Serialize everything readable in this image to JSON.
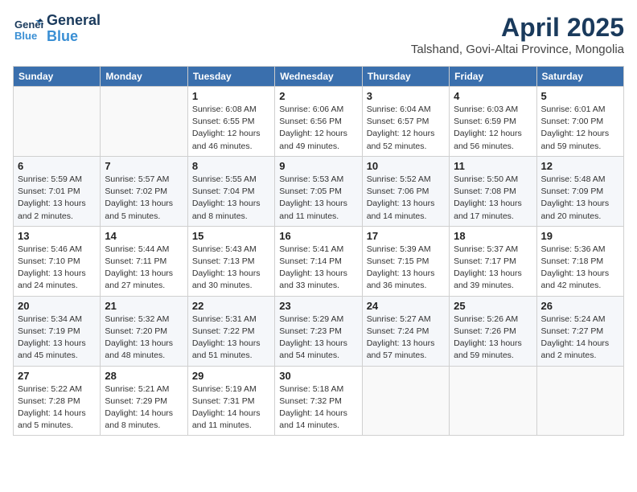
{
  "header": {
    "logo_line1": "General",
    "logo_line2": "Blue",
    "month_year": "April 2025",
    "location": "Talshand, Govi-Altai Province, Mongolia"
  },
  "weekdays": [
    "Sunday",
    "Monday",
    "Tuesday",
    "Wednesday",
    "Thursday",
    "Friday",
    "Saturday"
  ],
  "weeks": [
    [
      {
        "day": "",
        "detail": ""
      },
      {
        "day": "",
        "detail": ""
      },
      {
        "day": "1",
        "detail": "Sunrise: 6:08 AM\nSunset: 6:55 PM\nDaylight: 12 hours\nand 46 minutes."
      },
      {
        "day": "2",
        "detail": "Sunrise: 6:06 AM\nSunset: 6:56 PM\nDaylight: 12 hours\nand 49 minutes."
      },
      {
        "day": "3",
        "detail": "Sunrise: 6:04 AM\nSunset: 6:57 PM\nDaylight: 12 hours\nand 52 minutes."
      },
      {
        "day": "4",
        "detail": "Sunrise: 6:03 AM\nSunset: 6:59 PM\nDaylight: 12 hours\nand 56 minutes."
      },
      {
        "day": "5",
        "detail": "Sunrise: 6:01 AM\nSunset: 7:00 PM\nDaylight: 12 hours\nand 59 minutes."
      }
    ],
    [
      {
        "day": "6",
        "detail": "Sunrise: 5:59 AM\nSunset: 7:01 PM\nDaylight: 13 hours\nand 2 minutes."
      },
      {
        "day": "7",
        "detail": "Sunrise: 5:57 AM\nSunset: 7:02 PM\nDaylight: 13 hours\nand 5 minutes."
      },
      {
        "day": "8",
        "detail": "Sunrise: 5:55 AM\nSunset: 7:04 PM\nDaylight: 13 hours\nand 8 minutes."
      },
      {
        "day": "9",
        "detail": "Sunrise: 5:53 AM\nSunset: 7:05 PM\nDaylight: 13 hours\nand 11 minutes."
      },
      {
        "day": "10",
        "detail": "Sunrise: 5:52 AM\nSunset: 7:06 PM\nDaylight: 13 hours\nand 14 minutes."
      },
      {
        "day": "11",
        "detail": "Sunrise: 5:50 AM\nSunset: 7:08 PM\nDaylight: 13 hours\nand 17 minutes."
      },
      {
        "day": "12",
        "detail": "Sunrise: 5:48 AM\nSunset: 7:09 PM\nDaylight: 13 hours\nand 20 minutes."
      }
    ],
    [
      {
        "day": "13",
        "detail": "Sunrise: 5:46 AM\nSunset: 7:10 PM\nDaylight: 13 hours\nand 24 minutes."
      },
      {
        "day": "14",
        "detail": "Sunrise: 5:44 AM\nSunset: 7:11 PM\nDaylight: 13 hours\nand 27 minutes."
      },
      {
        "day": "15",
        "detail": "Sunrise: 5:43 AM\nSunset: 7:13 PM\nDaylight: 13 hours\nand 30 minutes."
      },
      {
        "day": "16",
        "detail": "Sunrise: 5:41 AM\nSunset: 7:14 PM\nDaylight: 13 hours\nand 33 minutes."
      },
      {
        "day": "17",
        "detail": "Sunrise: 5:39 AM\nSunset: 7:15 PM\nDaylight: 13 hours\nand 36 minutes."
      },
      {
        "day": "18",
        "detail": "Sunrise: 5:37 AM\nSunset: 7:17 PM\nDaylight: 13 hours\nand 39 minutes."
      },
      {
        "day": "19",
        "detail": "Sunrise: 5:36 AM\nSunset: 7:18 PM\nDaylight: 13 hours\nand 42 minutes."
      }
    ],
    [
      {
        "day": "20",
        "detail": "Sunrise: 5:34 AM\nSunset: 7:19 PM\nDaylight: 13 hours\nand 45 minutes."
      },
      {
        "day": "21",
        "detail": "Sunrise: 5:32 AM\nSunset: 7:20 PM\nDaylight: 13 hours\nand 48 minutes."
      },
      {
        "day": "22",
        "detail": "Sunrise: 5:31 AM\nSunset: 7:22 PM\nDaylight: 13 hours\nand 51 minutes."
      },
      {
        "day": "23",
        "detail": "Sunrise: 5:29 AM\nSunset: 7:23 PM\nDaylight: 13 hours\nand 54 minutes."
      },
      {
        "day": "24",
        "detail": "Sunrise: 5:27 AM\nSunset: 7:24 PM\nDaylight: 13 hours\nand 57 minutes."
      },
      {
        "day": "25",
        "detail": "Sunrise: 5:26 AM\nSunset: 7:26 PM\nDaylight: 13 hours\nand 59 minutes."
      },
      {
        "day": "26",
        "detail": "Sunrise: 5:24 AM\nSunset: 7:27 PM\nDaylight: 14 hours\nand 2 minutes."
      }
    ],
    [
      {
        "day": "27",
        "detail": "Sunrise: 5:22 AM\nSunset: 7:28 PM\nDaylight: 14 hours\nand 5 minutes."
      },
      {
        "day": "28",
        "detail": "Sunrise: 5:21 AM\nSunset: 7:29 PM\nDaylight: 14 hours\nand 8 minutes."
      },
      {
        "day": "29",
        "detail": "Sunrise: 5:19 AM\nSunset: 7:31 PM\nDaylight: 14 hours\nand 11 minutes."
      },
      {
        "day": "30",
        "detail": "Sunrise: 5:18 AM\nSunset: 7:32 PM\nDaylight: 14 hours\nand 14 minutes."
      },
      {
        "day": "",
        "detail": ""
      },
      {
        "day": "",
        "detail": ""
      },
      {
        "day": "",
        "detail": ""
      }
    ]
  ]
}
